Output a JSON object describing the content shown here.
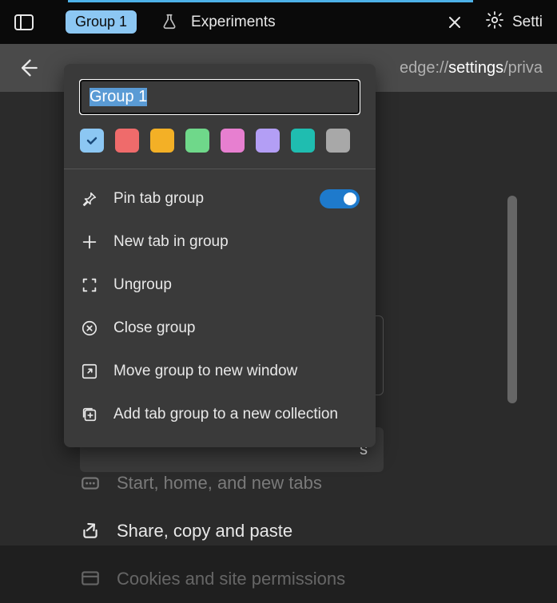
{
  "tabBar": {
    "groupChip": "Group 1",
    "tab": {
      "label": "Experiments"
    },
    "settingsLabel": "Setti"
  },
  "address": {
    "prefix": "edge://",
    "highlight": "settings",
    "suffix": "/priva"
  },
  "obscuredSuffix": "s",
  "nav": [
    {
      "label": "Start, home, and new tabs",
      "icon": "home-more-icon"
    },
    {
      "label": "Share, copy and paste",
      "icon": "share-icon"
    },
    {
      "label": "Cookies and site permissions",
      "icon": "cookies-icon"
    }
  ],
  "menu": {
    "nameInput": "Group 1",
    "colors": [
      {
        "hex": "#8cc7f3",
        "checked": true
      },
      {
        "hex": "#ef6b6b",
        "checked": false
      },
      {
        "hex": "#f3b026",
        "checked": false
      },
      {
        "hex": "#6fd88a",
        "checked": false
      },
      {
        "hex": "#e77fd0",
        "checked": false
      },
      {
        "hex": "#b39ef5",
        "checked": false
      },
      {
        "hex": "#1fbdb0",
        "checked": false
      },
      {
        "hex": "#a8a8a8",
        "checked": false
      }
    ],
    "items": [
      {
        "icon": "pin-icon",
        "label": "Pin tab group",
        "hasToggle": true,
        "toggleOn": true
      },
      {
        "icon": "plus-icon",
        "label": "New tab in group"
      },
      {
        "icon": "ungroup-icon",
        "label": "Ungroup"
      },
      {
        "icon": "close-circle-icon",
        "label": "Close group"
      },
      {
        "icon": "window-arrow-icon",
        "label": "Move group to new window"
      },
      {
        "icon": "collection-add-icon",
        "label": "Add tab group to a new collection"
      }
    ]
  }
}
